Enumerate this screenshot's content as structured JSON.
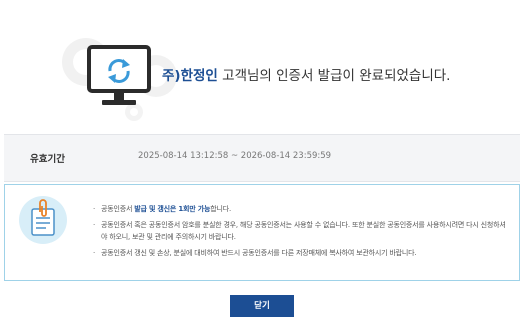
{
  "header": {
    "company": "주)한정인",
    "message": " 고객님의 인증서 발급이 완료되었습니다."
  },
  "validity": {
    "label": "유효기간",
    "range": "2025-08-14 13:12:58 ~ 2026-08-14 23:59:59"
  },
  "notices": [
    {
      "parts": [
        "공동인증서 ",
        "발급 및 갱신은 1회만 가능",
        "합니다."
      ]
    },
    {
      "text": "공동인증서 혹은 공동인증서 암호를 분실한 경우, 해당 공동인증서는 사용할 수 없습니다. 또한 분실한 공동인증서를 사용하시려면 다시 신청하셔야 하오니, 보관 및 관리에 주의하시기 바랍니다."
    },
    {
      "text": "공동인증서 갱신 및 손상, 분실에 대비하여 반드시 공동인증서를 다른 저장매체에 복사하여 보관하시기 바랍니다."
    }
  ],
  "buttons": {
    "close": "닫기"
  },
  "colors": {
    "brand": "#1d4f94",
    "notice_border": "#9fd2e8",
    "panel_bg": "#f4f5f7"
  }
}
